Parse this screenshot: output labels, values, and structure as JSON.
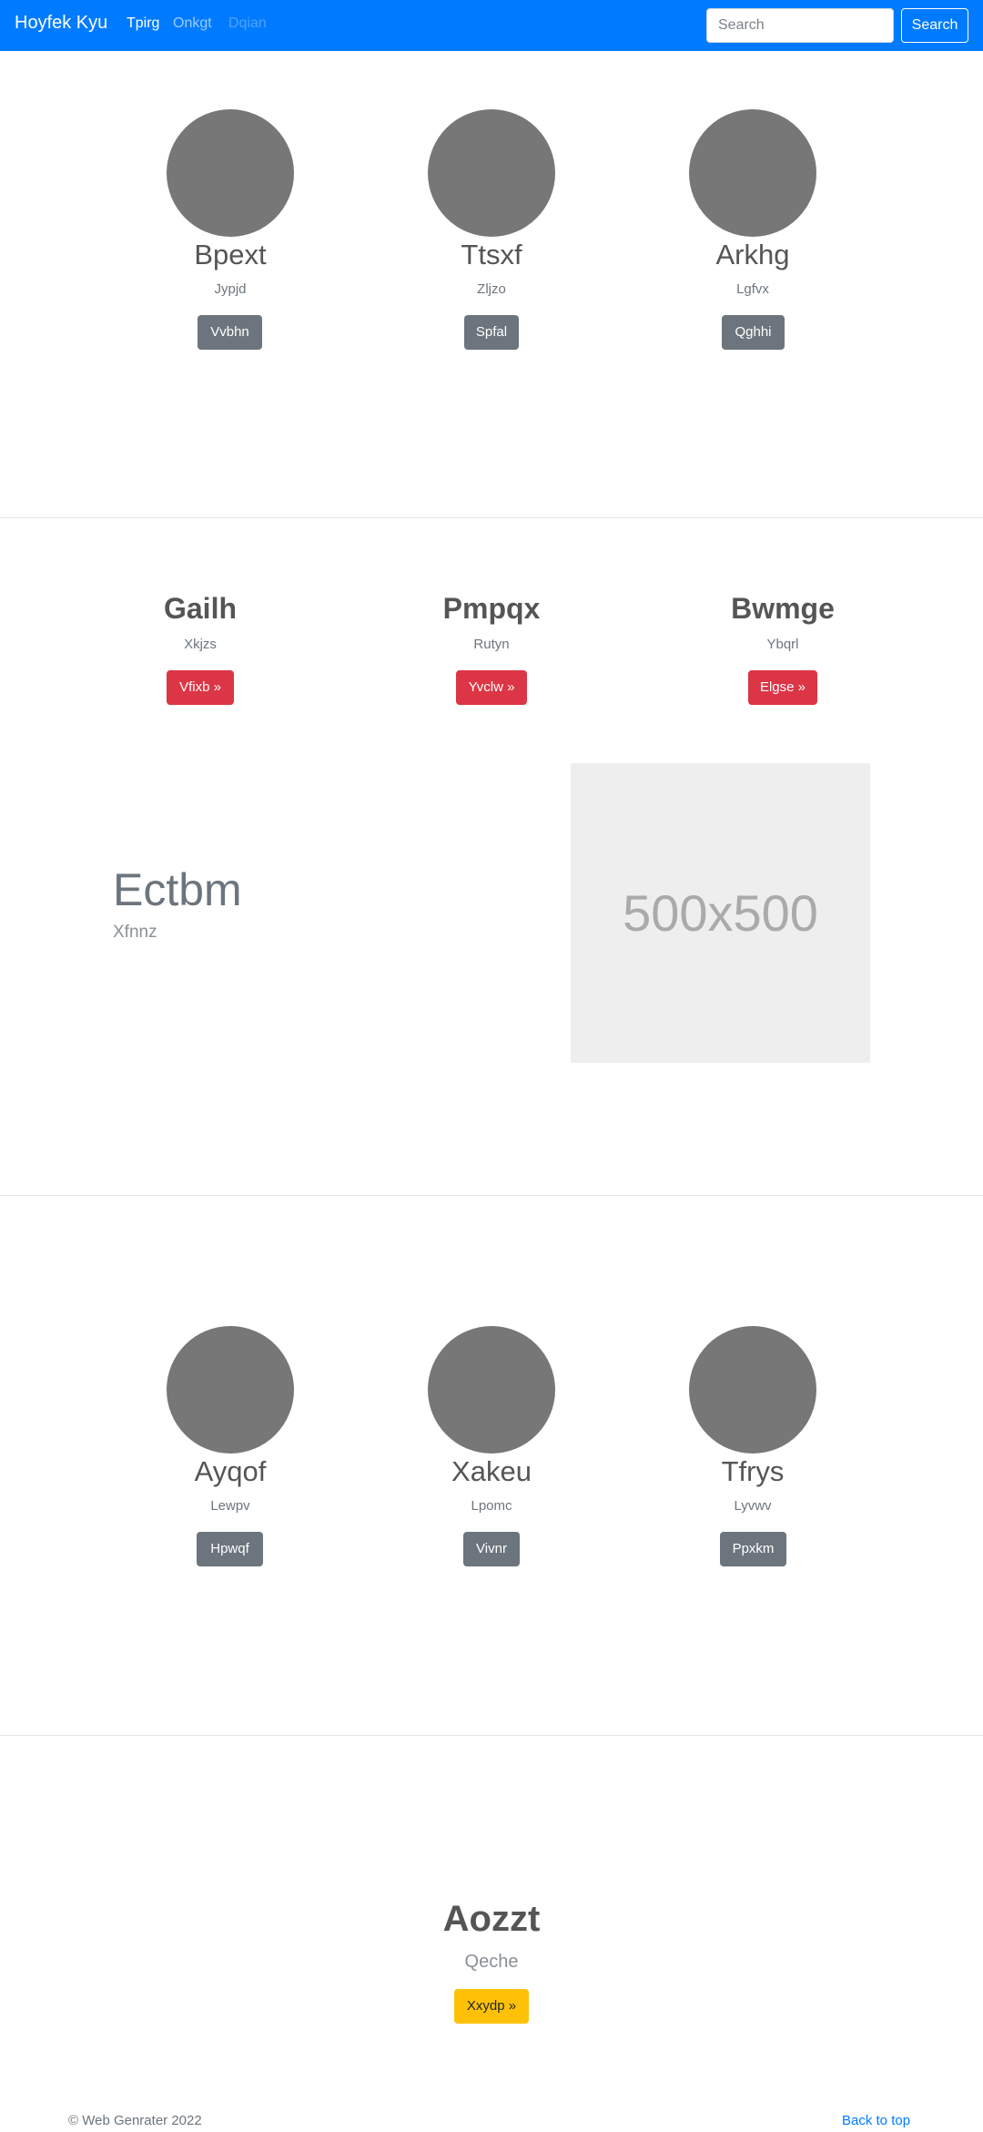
{
  "navbar": {
    "brand": "Hoyfek Kyu",
    "links": [
      "Tpirg",
      "Onkgt",
      "Dqian"
    ],
    "search_placeholder": "Search",
    "search_button": "Search"
  },
  "team_section_1": [
    {
      "name": "Bpext",
      "subtitle": "Jypjd",
      "button": "Vvbhn"
    },
    {
      "name": "Ttsxf",
      "subtitle": "Zljzo",
      "button": "Spfal"
    },
    {
      "name": "Arkhg",
      "subtitle": "Lgfvx",
      "button": "Qghhi"
    }
  ],
  "features": [
    {
      "title": "Gailh",
      "subtitle": "Xkjzs",
      "button": "Vfixb »"
    },
    {
      "title": "Pmpqx",
      "subtitle": "Rutyn",
      "button": "Yvclw »"
    },
    {
      "title": "Bwmge",
      "subtitle": "Ybqrl",
      "button": "Elgse »"
    }
  ],
  "hero": {
    "title": "Ectbm",
    "subtitle": "Xfnnz",
    "image_placeholder": "500x500"
  },
  "team_section_2": [
    {
      "name": "Ayqof",
      "subtitle": "Lewpv",
      "button": "Hpwqf"
    },
    {
      "name": "Xakeu",
      "subtitle": "Lpomc",
      "button": "Vivnr"
    },
    {
      "name": "Tfrys",
      "subtitle": "Lyvwv",
      "button": "Ppxkm"
    }
  ],
  "cta": {
    "title": "Aozzt",
    "subtitle": "Qeche",
    "button": "Xxydp »"
  },
  "footer": {
    "copyright": "© Web Genrater 2022",
    "back_to_top": "Back to top"
  },
  "colors": {
    "primary": "#007bff",
    "secondary": "#6c757d",
    "danger": "#dc3545",
    "warning": "#ffc107",
    "avatar": "#777777"
  }
}
